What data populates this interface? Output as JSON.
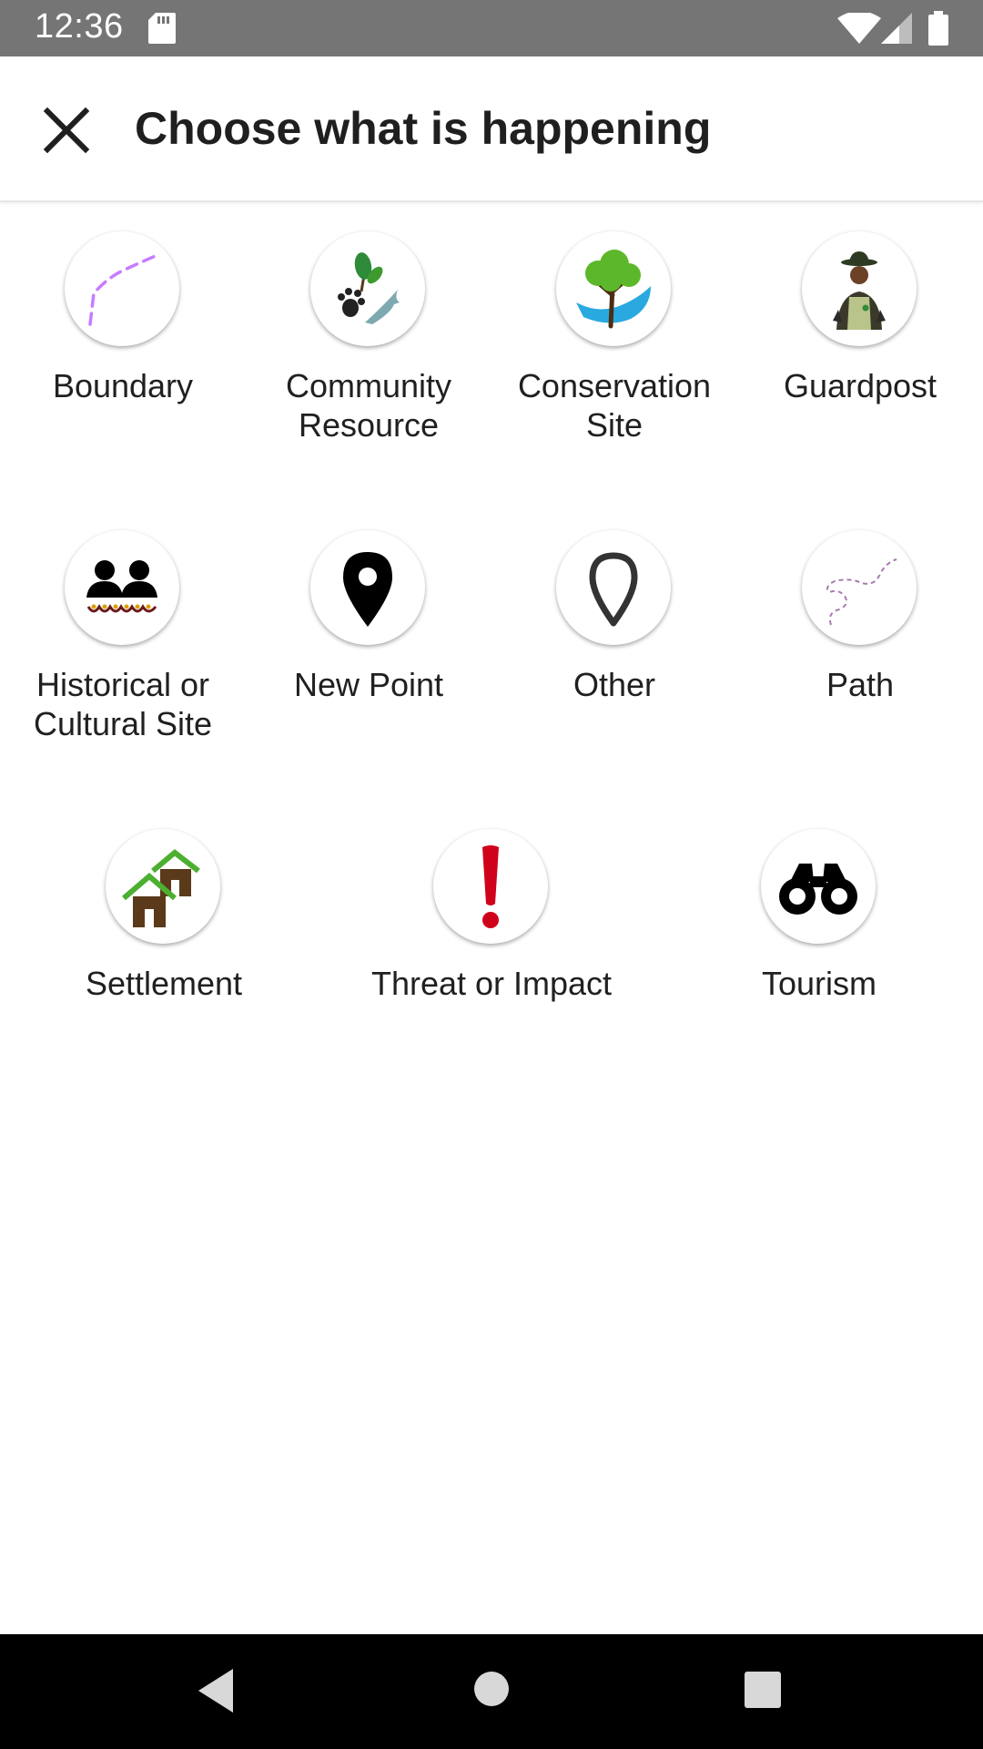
{
  "status_bar": {
    "time": "12:36",
    "icons": [
      "sd-card-icon",
      "wifi-icon",
      "cell-signal-icon",
      "battery-icon"
    ]
  },
  "header": {
    "title": "Choose what is happening",
    "close_icon": "close-icon"
  },
  "categories": [
    {
      "label": "Boundary",
      "icon": "boundary-icon"
    },
    {
      "label": "Community\nResource",
      "icon": "community-resource-icon"
    },
    {
      "label": "Conservation\nSite",
      "icon": "conservation-site-icon"
    },
    {
      "label": "Guardpost",
      "icon": "guardpost-icon"
    },
    {
      "label": "Historical or\nCultural Site",
      "icon": "historical-site-icon"
    },
    {
      "label": "New Point",
      "icon": "map-pin-icon"
    },
    {
      "label": "Other",
      "icon": "map-pin-outline-icon"
    },
    {
      "label": "Path",
      "icon": "path-icon"
    },
    {
      "label": "Settlement",
      "icon": "settlement-icon"
    },
    {
      "label": "Threat or Impact",
      "icon": "exclamation-icon"
    },
    {
      "label": "Tourism",
      "icon": "binoculars-icon"
    }
  ],
  "nav_bar": {
    "icons": [
      "back-icon",
      "home-icon",
      "recents-icon"
    ]
  },
  "colors": {
    "status_bar": "#757575",
    "nav_bar": "#000000",
    "boundary_line": "#c77dff",
    "threat_red": "#d0021b",
    "leaf_green": "#3c9a2f",
    "water_blue": "#29a9e0",
    "earth_brown": "#5a3a1a"
  }
}
